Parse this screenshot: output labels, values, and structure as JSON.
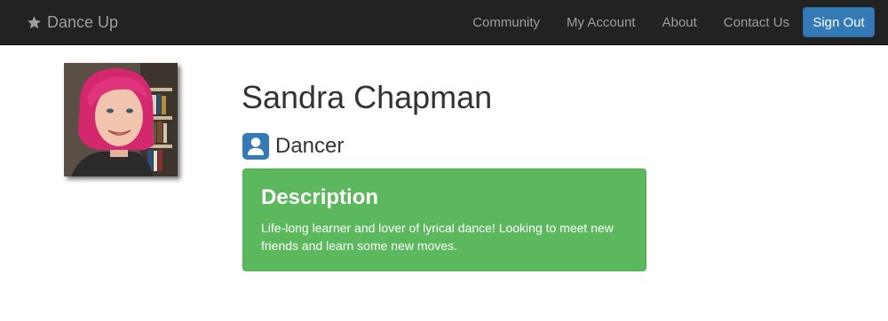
{
  "navbar": {
    "brand_label": "Dance Up",
    "brand_icon": "star-icon",
    "links": [
      {
        "label": "Community"
      },
      {
        "label": "My Account"
      },
      {
        "label": "About"
      },
      {
        "label": "Contact Us"
      }
    ],
    "signout_label": "Sign Out"
  },
  "profile": {
    "name": "Sandra Chapman",
    "role_icon": "user-icon",
    "role": "Dancer",
    "description": {
      "title": "Description",
      "text": "Life-long learner and lover of lyrical dance! Looking to meet new friends and learn some new moves."
    }
  },
  "colors": {
    "navbar_bg": "#222222",
    "nav_text": "#9d9d9d",
    "primary": "#337ab7",
    "success": "#5cb85c"
  }
}
